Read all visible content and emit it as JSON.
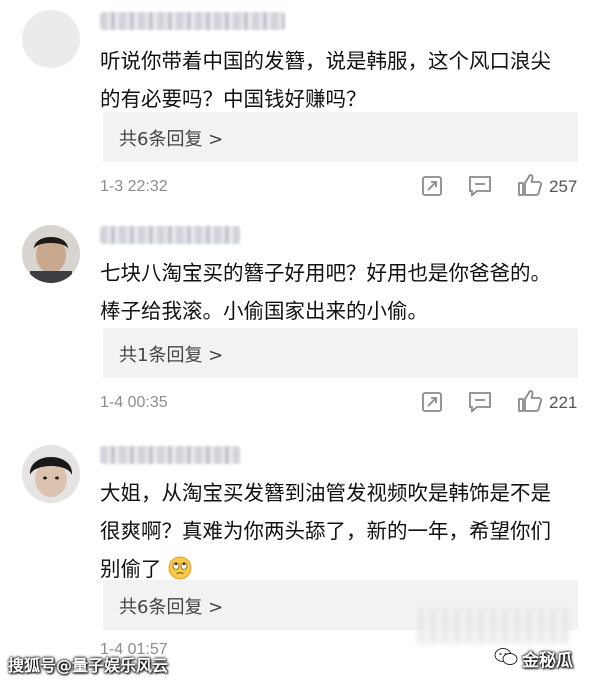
{
  "comments": [
    {
      "text_lines": [
        "听说你带着中国的发簪，说是韩服，这个风口浪尖",
        "的有必要吗？中国钱好赚吗？"
      ],
      "replies_label": "共6条回复 >",
      "time": "1-3 22:32",
      "likes": "257"
    },
    {
      "text_lines": [
        "七块八淘宝买的簪子好用吧？好用也是你爸爸的。",
        "棒子给我滚。小偷国家出来的小偷。"
      ],
      "replies_label": "共1条回复 >",
      "time": "1-4 00:35",
      "likes": "221"
    },
    {
      "text_lines": [
        "大姐，从淘宝买发簪到油管发视频吹是韩饰是不是",
        "很爽啊？真难为你两头舔了，新的一年，希望你们",
        "别偷了"
      ],
      "replies_label": "共6条回复 >",
      "time": "1-4 01:57"
    }
  ],
  "watermark": {
    "left": "搜狐号@量子娱乐风云",
    "right": "金秘瓜"
  },
  "icons": [
    "share-icon",
    "comment-icon",
    "thumbs-up-icon",
    "rolling-eyes-emoji",
    "wechat-logo"
  ],
  "colors": {
    "reply_box": "#f2f2f2",
    "meta_text": "#8d8d8d",
    "body_text": "#111111"
  }
}
